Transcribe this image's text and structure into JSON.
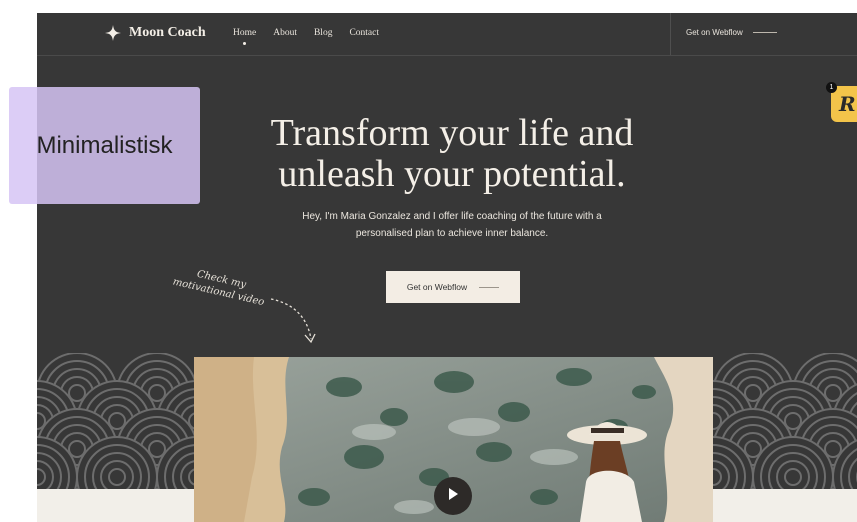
{
  "overlay": {
    "label": "Minimalistisk",
    "badge_letter": "R",
    "badge_count": "1"
  },
  "nav": {
    "brand": "Moon Coach",
    "links": [
      "Home",
      "About",
      "Blog",
      "Contact"
    ],
    "active": "Home",
    "cta": "Get on Webflow"
  },
  "hero": {
    "title_line1": "Transform your life and",
    "title_line2": "unleash your potential.",
    "subtitle_line1": "Hey, I'm Maria Gonzalez and I offer life coaching of the future with a",
    "subtitle_line2": "personalised plan to achieve inner balance.",
    "button": "Get on Webflow",
    "note_line1": "Check my",
    "note_line2": "motivational video"
  },
  "icons": {
    "brand": "four-point-star-icon",
    "video": "play-icon",
    "note": "dashed-curved-arrow-icon"
  },
  "colors": {
    "background": "#373737",
    "text": "#f4efe7",
    "button_bg": "#f3ede4",
    "badge": "#f3c44a"
  }
}
